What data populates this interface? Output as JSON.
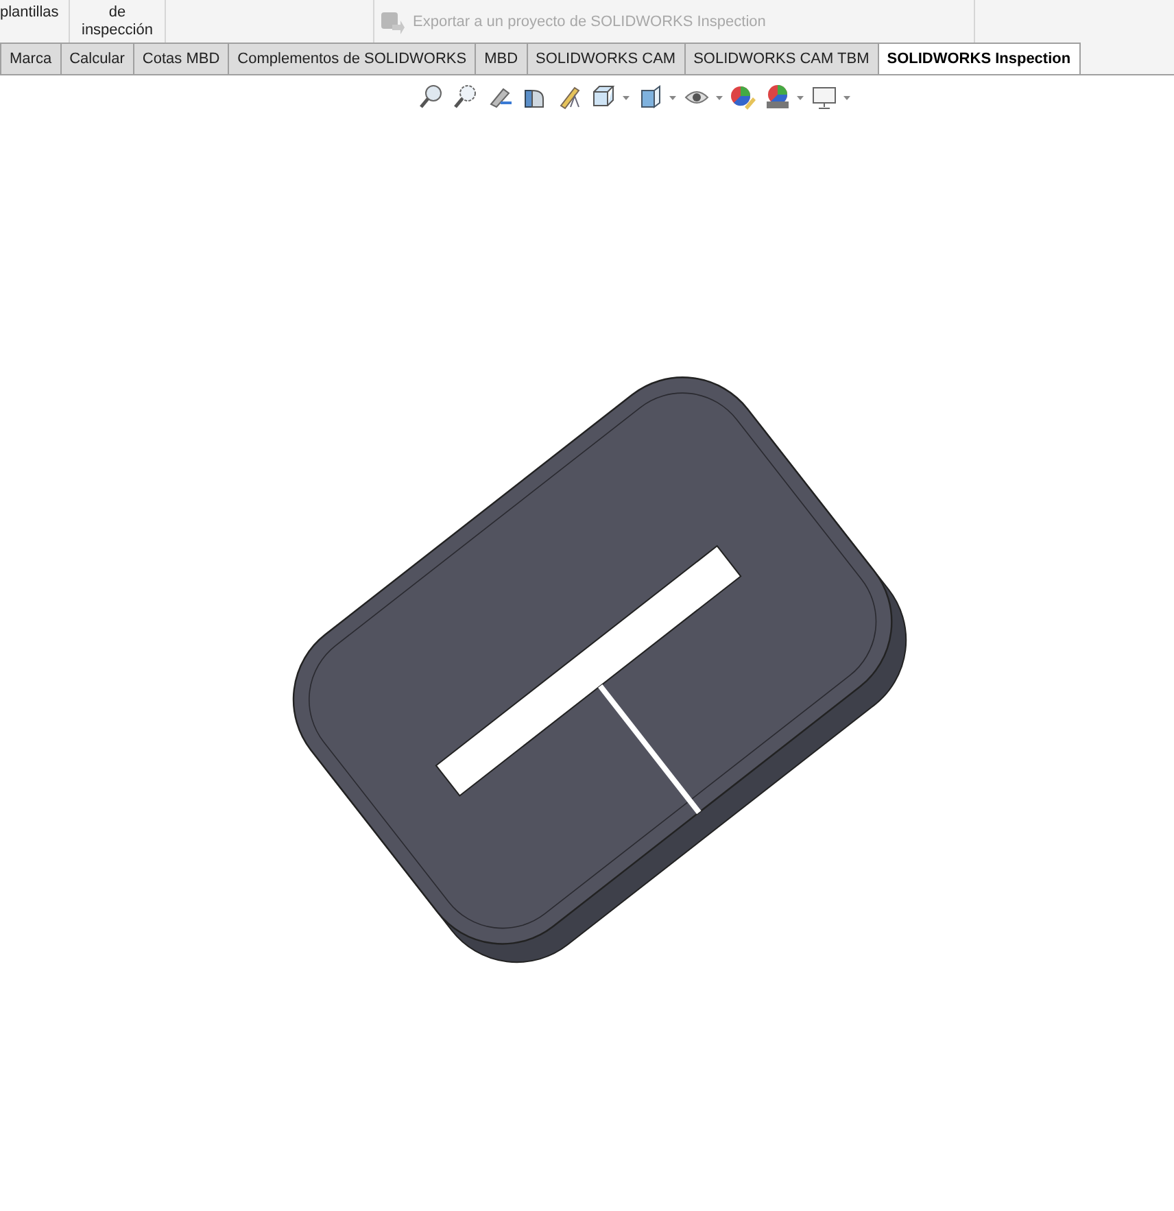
{
  "ribbon": {
    "buttons": [
      {
        "label": "plantillas"
      },
      {
        "label": "de\ninspección"
      }
    ],
    "export": {
      "label": "Exportar a un proyecto de SOLIDWORKS Inspection",
      "disabled": true
    }
  },
  "tabs": [
    {
      "label": "Marca",
      "selected": false
    },
    {
      "label": "Calcular",
      "selected": false
    },
    {
      "label": "Cotas MBD",
      "selected": false
    },
    {
      "label": "Complementos de SOLIDWORKS",
      "selected": false
    },
    {
      "label": "MBD",
      "selected": false
    },
    {
      "label": "SOLIDWORKS CAM",
      "selected": false
    },
    {
      "label": "SOLIDWORKS CAM TBM",
      "selected": false
    },
    {
      "label": "SOLIDWORKS Inspection",
      "selected": true
    }
  ],
  "view_toolbar": [
    {
      "kind": "button"
    },
    {
      "kind": "button"
    },
    {
      "kind": "button"
    },
    {
      "kind": "button"
    },
    {
      "kind": "button"
    },
    {
      "kind": "dropdown"
    },
    {
      "kind": "dropdown"
    },
    {
      "kind": "dropdown"
    },
    {
      "kind": "button"
    },
    {
      "kind": "dropdown"
    },
    {
      "kind": "dropdown"
    }
  ]
}
